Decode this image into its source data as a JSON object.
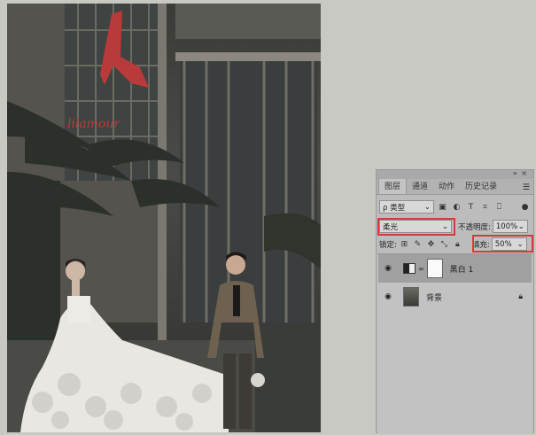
{
  "panel": {
    "tabs": [
      "图层",
      "通道",
      "动作",
      "历史记录"
    ],
    "active_tab": "图层",
    "menu_icon": "menu-lines-icon",
    "close_icons": "»  ×",
    "kind_filter": "ρ 类型",
    "blend_mode": "柔光",
    "opacity_label": "不透明度:",
    "opacity_value": "100%",
    "lock_label": "锁定:",
    "fill_label": "填充:",
    "fill_value": "50%",
    "highlight_color": "#d73a3a",
    "layers": [
      {
        "name": "黑白 1",
        "type": "adjustment",
        "selected": true
      },
      {
        "name": "背景",
        "type": "image",
        "locked": true
      }
    ]
  }
}
